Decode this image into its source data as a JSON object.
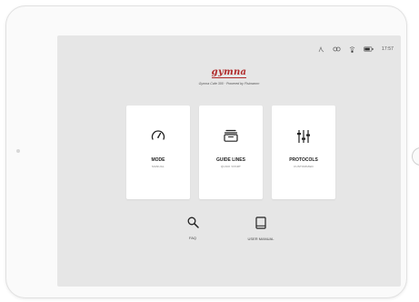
{
  "status_bar": {
    "time": "17:57",
    "icons": [
      "signal-icon",
      "link-icon",
      "wifi-icon",
      "battery-icon"
    ]
  },
  "brand": {
    "logo": "gymna",
    "subtitle": "Gymna Cafe 300 · Powered by Fisioworm",
    "color": "#b02a2a"
  },
  "cards": [
    {
      "title": "MODE",
      "subtitle": "MANUAL",
      "icon": "gauge-icon"
    },
    {
      "title": "GUIDE LINES",
      "subtitle": "QUICK START",
      "icon": "stack-icon"
    },
    {
      "title": "PROTOCOLS",
      "subtitle": "CUSTOMIZED",
      "icon": "sliders-icon"
    }
  ],
  "links": [
    {
      "label": "FAQ",
      "icon": "search-icon"
    },
    {
      "label": "USER MANUAL",
      "icon": "book-icon"
    }
  ]
}
